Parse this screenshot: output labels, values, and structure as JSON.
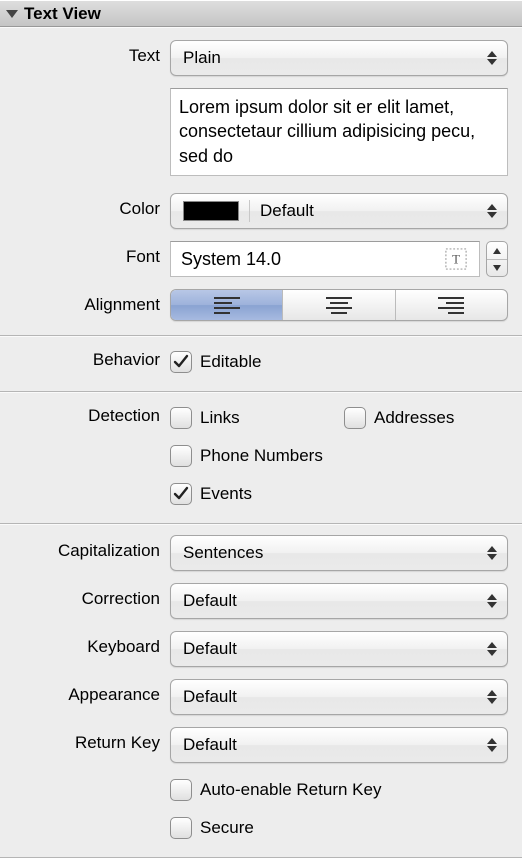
{
  "header": {
    "title": "Text View"
  },
  "text": {
    "label": "Text",
    "mode": "Plain",
    "content": "Lorem ipsum dolor sit er elit lamet, consectetaur cillium adipisicing pecu, sed do"
  },
  "color": {
    "label": "Color",
    "value": "Default",
    "swatch": "#000000"
  },
  "font": {
    "label": "Font",
    "value": "System 14.0"
  },
  "alignment": {
    "label": "Alignment",
    "selected": "left"
  },
  "behavior": {
    "label": "Behavior",
    "editable_label": "Editable",
    "editable": true
  },
  "detection": {
    "label": "Detection",
    "links_label": "Links",
    "links": false,
    "addresses_label": "Addresses",
    "addresses": false,
    "phone_label": "Phone Numbers",
    "phone": false,
    "events_label": "Events",
    "events": true
  },
  "capitalization": {
    "label": "Capitalization",
    "value": "Sentences"
  },
  "correction": {
    "label": "Correction",
    "value": "Default"
  },
  "keyboard": {
    "label": "Keyboard",
    "value": "Default"
  },
  "appearance": {
    "label": "Appearance",
    "value": "Default"
  },
  "returnKey": {
    "label": "Return Key",
    "value": "Default",
    "auto_label": "Auto-enable Return Key",
    "auto": false,
    "secure_label": "Secure",
    "secure": false
  }
}
